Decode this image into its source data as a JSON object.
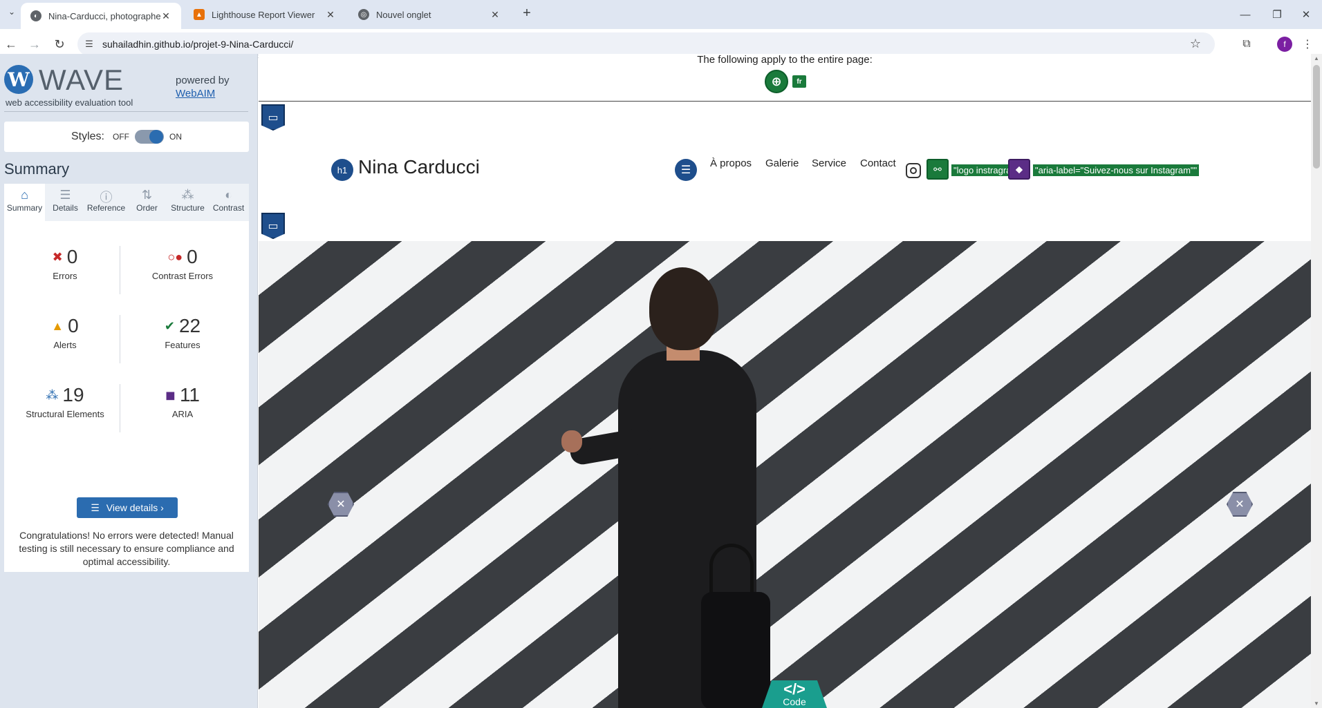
{
  "browser": {
    "tabs": [
      {
        "title": "Nina-Carducci, photographe",
        "active": true
      },
      {
        "title": "Lighthouse Report Viewer",
        "active": false
      },
      {
        "title": "Nouvel onglet",
        "active": false
      }
    ],
    "url": "suhailadhin.github.io/projet-9-Nina-Carducci/",
    "profile_initial": "f"
  },
  "wave": {
    "logo_letter": "W",
    "title": "WAVE",
    "subtitle": "web accessibility evaluation tool",
    "powered_by": "powered by",
    "webaim": "WebAIM",
    "styles_label": "Styles:",
    "styles_off": "OFF",
    "styles_on": "ON",
    "summary_heading": "Summary",
    "tabs": [
      "Summary",
      "Details",
      "Reference",
      "Order",
      "Structure",
      "Contrast"
    ],
    "stats": {
      "errors": {
        "value": "0",
        "label": "Errors"
      },
      "contrast": {
        "value": "0",
        "label": "Contrast Errors"
      },
      "alerts": {
        "value": "0",
        "label": "Alerts"
      },
      "features": {
        "value": "22",
        "label": "Features"
      },
      "structure": {
        "value": "19",
        "label": "Structural Elements"
      },
      "aria": {
        "value": "11",
        "label": "ARIA"
      }
    },
    "view_details": "View details ›",
    "congrats": "Congratulations! No errors were detected! Manual testing is still necessary to ensure compliance and optimal accessibility."
  },
  "page": {
    "apply_text": "The following apply to the entire page:",
    "lang_badge": "fr",
    "h1_badge": "h1",
    "site_title": "Nina Carducci",
    "nav": [
      "À propos",
      "Galerie",
      "Service",
      "Contact"
    ],
    "alt_label": "\"logo instragram\"",
    "aria_label": "\"aria-label=\"Suivez-nous sur Instagram\"\"",
    "code_badge": "</>",
    "code_label": "Code"
  },
  "colors": {
    "wave_blue": "#2b6cb0",
    "feature_green": "#1a7a3b",
    "aria_purple": "#5b2d86",
    "error_red": "#c62828"
  }
}
